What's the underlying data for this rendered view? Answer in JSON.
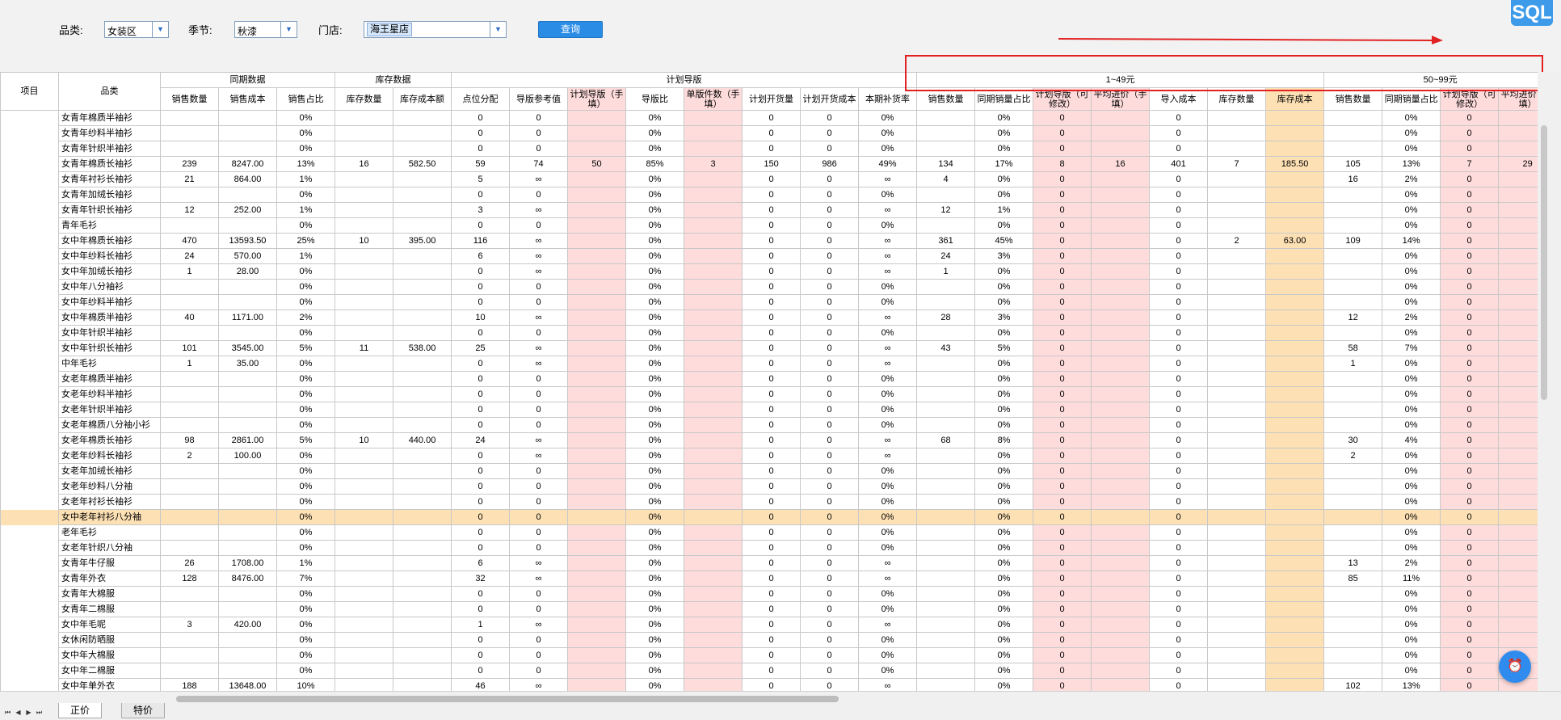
{
  "filters": {
    "category_label": "品类:",
    "category_value": "女装区",
    "season_label": "季节:",
    "season_value": "秋漆",
    "store_label": "门店:",
    "store_value": "海王星店",
    "query_label": "查询"
  },
  "sql_badge": "SQL",
  "float_button_icon": "notification-icon",
  "header_groups": {
    "item": "项目",
    "category": "品类",
    "prior": "同期数据",
    "stock": "库存数据",
    "plan": "计划导版",
    "price1": "1~49元",
    "price2": "50~99元"
  },
  "columns": [
    "销售数量",
    "销售成本",
    "销售占比",
    "库存数量",
    "库存成本额",
    "点位分配",
    "导版参考值",
    "计划导版（手填）",
    "导版比",
    "单版件数（手填）",
    "计划开货量",
    "计划开货成本",
    "本期补货率",
    "销售数量",
    "同期销量占比",
    "计划导版（可修改）",
    "平均进价（手填）",
    "导入成本",
    "库存数量",
    "库存成本",
    "销售数量",
    "同期销量占比",
    "计划导版（可修改）",
    "平均进价（手填）"
  ],
  "rows": [
    [
      "女青年棉质半袖衫",
      "",
      "",
      "0%",
      "",
      "",
      "0",
      "0",
      "",
      "0%",
      "",
      "0",
      "0",
      "0%",
      "",
      "0%",
      "0",
      "",
      "0",
      "",
      "",
      "",
      "0%",
      "0",
      ""
    ],
    [
      "女青年纱料半袖衫",
      "",
      "",
      "0%",
      "",
      "",
      "0",
      "0",
      "",
      "0%",
      "",
      "0",
      "0",
      "0%",
      "",
      "0%",
      "0",
      "",
      "0",
      "",
      "",
      "",
      "0%",
      "0",
      ""
    ],
    [
      "女青年针织半袖衫",
      "",
      "",
      "0%",
      "",
      "",
      "0",
      "0",
      "",
      "0%",
      "",
      "0",
      "0",
      "0%",
      "",
      "0%",
      "0",
      "",
      "0",
      "",
      "",
      "",
      "0%",
      "0",
      ""
    ],
    [
      "女青年棉质长袖衫",
      "239",
      "8247.00",
      "13%",
      "16",
      "582.50",
      "59",
      "74",
      "50",
      "85%",
      "3",
      "150",
      "986",
      "49%",
      "134",
      "17%",
      "8",
      "16",
      "401",
      "7",
      "185.50",
      "105",
      "13%",
      "7",
      "29"
    ],
    [
      "女青年衬衫长袖衫",
      "21",
      "864.00",
      "1%",
      "",
      "",
      "5",
      "∞",
      "",
      "0%",
      "",
      "0",
      "0",
      "∞",
      "4",
      "0%",
      "0",
      "",
      "0",
      "",
      "",
      "16",
      "2%",
      "0",
      ""
    ],
    [
      "女青年加绒长袖衫",
      "",
      "",
      "0%",
      "",
      "",
      "0",
      "0",
      "",
      "0%",
      "",
      "0",
      "0",
      "0%",
      "",
      "0%",
      "0",
      "",
      "0",
      "",
      "",
      "",
      "0%",
      "0",
      ""
    ],
    [
      "女青年针织长袖衫",
      "12",
      "252.00",
      "1%",
      "",
      "",
      "3",
      "∞",
      "",
      "0%",
      "",
      "0",
      "0",
      "∞",
      "12",
      "1%",
      "0",
      "",
      "0",
      "",
      "",
      "",
      "0%",
      "0",
      ""
    ],
    [
      "青年毛衫",
      "",
      "",
      "0%",
      "",
      "",
      "0",
      "0",
      "",
      "0%",
      "",
      "0",
      "0",
      "0%",
      "",
      "0%",
      "0",
      "",
      "0",
      "",
      "",
      "",
      "0%",
      "0",
      ""
    ],
    [
      "女中年棉质长袖衫",
      "470",
      "13593.50",
      "25%",
      "10",
      "395.00",
      "116",
      "∞",
      "",
      "0%",
      "",
      "0",
      "0",
      "∞",
      "361",
      "45%",
      "0",
      "",
      "0",
      "2",
      "63.00",
      "109",
      "14%",
      "0",
      ""
    ],
    [
      "女中年纱料长袖衫",
      "24",
      "570.00",
      "1%",
      "",
      "",
      "6",
      "∞",
      "",
      "0%",
      "",
      "0",
      "0",
      "∞",
      "24",
      "3%",
      "0",
      "",
      "0",
      "",
      "",
      "",
      "0%",
      "0",
      ""
    ],
    [
      "女中年加绒长袖衫",
      "1",
      "28.00",
      "0%",
      "",
      "",
      "0",
      "∞",
      "",
      "0%",
      "",
      "0",
      "0",
      "∞",
      "1",
      "0%",
      "0",
      "",
      "0",
      "",
      "",
      "",
      "0%",
      "0",
      ""
    ],
    [
      "女中年八分袖衫",
      "",
      "",
      "0%",
      "",
      "",
      "0",
      "0",
      "",
      "0%",
      "",
      "0",
      "0",
      "0%",
      "",
      "0%",
      "0",
      "",
      "0",
      "",
      "",
      "",
      "0%",
      "0",
      ""
    ],
    [
      "女中年纱料半袖衫",
      "",
      "",
      "0%",
      "",
      "",
      "0",
      "0",
      "",
      "0%",
      "",
      "0",
      "0",
      "0%",
      "",
      "0%",
      "0",
      "",
      "0",
      "",
      "",
      "",
      "0%",
      "0",
      ""
    ],
    [
      "女中年棉质半袖衫",
      "40",
      "1171.00",
      "2%",
      "",
      "",
      "10",
      "∞",
      "",
      "0%",
      "",
      "0",
      "0",
      "∞",
      "28",
      "3%",
      "0",
      "",
      "0",
      "",
      "",
      "12",
      "2%",
      "0",
      ""
    ],
    [
      "女中年针织半袖衫",
      "",
      "",
      "0%",
      "",
      "",
      "0",
      "0",
      "",
      "0%",
      "",
      "0",
      "0",
      "0%",
      "",
      "0%",
      "0",
      "",
      "0",
      "",
      "",
      "",
      "0%",
      "0",
      ""
    ],
    [
      "女中年针织长袖衫",
      "101",
      "3545.00",
      "5%",
      "11",
      "538.00",
      "25",
      "∞",
      "",
      "0%",
      "",
      "0",
      "0",
      "∞",
      "43",
      "5%",
      "0",
      "",
      "0",
      "",
      "",
      "58",
      "7%",
      "0",
      ""
    ],
    [
      "中年毛衫",
      "1",
      "35.00",
      "0%",
      "",
      "",
      "0",
      "∞",
      "",
      "0%",
      "",
      "0",
      "0",
      "∞",
      "",
      "0%",
      "0",
      "",
      "0",
      "",
      "",
      "1",
      "0%",
      "0",
      ""
    ],
    [
      "女老年棉质半袖衫",
      "",
      "",
      "0%",
      "",
      "",
      "0",
      "0",
      "",
      "0%",
      "",
      "0",
      "0",
      "0%",
      "",
      "0%",
      "0",
      "",
      "0",
      "",
      "",
      "",
      "0%",
      "0",
      ""
    ],
    [
      "女老年纱料半袖衫",
      "",
      "",
      "0%",
      "",
      "",
      "0",
      "0",
      "",
      "0%",
      "",
      "0",
      "0",
      "0%",
      "",
      "0%",
      "0",
      "",
      "0",
      "",
      "",
      "",
      "0%",
      "0",
      ""
    ],
    [
      "女老年针织半袖衫",
      "",
      "",
      "0%",
      "",
      "",
      "0",
      "0",
      "",
      "0%",
      "",
      "0",
      "0",
      "0%",
      "",
      "0%",
      "0",
      "",
      "0",
      "",
      "",
      "",
      "0%",
      "0",
      ""
    ],
    [
      "女老年棉质八分袖小衫",
      "",
      "",
      "0%",
      "",
      "",
      "0",
      "0",
      "",
      "0%",
      "",
      "0",
      "0",
      "0%",
      "",
      "0%",
      "0",
      "",
      "0",
      "",
      "",
      "",
      "0%",
      "0",
      ""
    ],
    [
      "女老年棉质长袖衫",
      "98",
      "2861.00",
      "5%",
      "10",
      "440.00",
      "24",
      "∞",
      "",
      "0%",
      "",
      "0",
      "0",
      "∞",
      "68",
      "8%",
      "0",
      "",
      "0",
      "",
      "",
      "30",
      "4%",
      "0",
      ""
    ],
    [
      "女老年纱料长袖衫",
      "2",
      "100.00",
      "0%",
      "",
      "",
      "0",
      "∞",
      "",
      "0%",
      "",
      "0",
      "0",
      "∞",
      "",
      "0%",
      "0",
      "",
      "0",
      "",
      "",
      "2",
      "0%",
      "0",
      ""
    ],
    [
      "女老年加绒长袖衫",
      "",
      "",
      "0%",
      "",
      "",
      "0",
      "0",
      "",
      "0%",
      "",
      "0",
      "0",
      "0%",
      "",
      "0%",
      "0",
      "",
      "0",
      "",
      "",
      "",
      "0%",
      "0",
      ""
    ],
    [
      "女老年纱料八分袖",
      "",
      "",
      "0%",
      "",
      "",
      "0",
      "0",
      "",
      "0%",
      "",
      "0",
      "0",
      "0%",
      "",
      "0%",
      "0",
      "",
      "0",
      "",
      "",
      "",
      "0%",
      "0",
      ""
    ],
    [
      "女老年衬衫长袖衫",
      "",
      "",
      "0%",
      "",
      "",
      "0",
      "0",
      "",
      "0%",
      "",
      "0",
      "0",
      "0%",
      "",
      "0%",
      "0",
      "",
      "0",
      "",
      "",
      "",
      "0%",
      "0",
      ""
    ],
    [
      "女中老年衬衫八分袖",
      "",
      "",
      "0%",
      "",
      "",
      "0",
      "0",
      "",
      "0%",
      "",
      "0",
      "0",
      "0%",
      "",
      "0%",
      "0",
      "",
      "0",
      "",
      "",
      "",
      "0%",
      "0",
      ""
    ],
    [
      "老年毛衫",
      "",
      "",
      "0%",
      "",
      "",
      "0",
      "0",
      "",
      "0%",
      "",
      "0",
      "0",
      "0%",
      "",
      "0%",
      "0",
      "",
      "0",
      "",
      "",
      "",
      "0%",
      "0",
      ""
    ],
    [
      "女老年针织八分袖",
      "",
      "",
      "0%",
      "",
      "",
      "0",
      "0",
      "",
      "0%",
      "",
      "0",
      "0",
      "0%",
      "",
      "0%",
      "0",
      "",
      "0",
      "",
      "",
      "",
      "0%",
      "0",
      ""
    ],
    [
      "女青年牛仔服",
      "26",
      "1708.00",
      "1%",
      "",
      "",
      "6",
      "∞",
      "",
      "0%",
      "",
      "0",
      "0",
      "∞",
      "",
      "0%",
      "0",
      "",
      "0",
      "",
      "",
      "13",
      "2%",
      "0",
      ""
    ],
    [
      "女青年外衣",
      "128",
      "8476.00",
      "7%",
      "",
      "",
      "32",
      "∞",
      "",
      "0%",
      "",
      "0",
      "0",
      "∞",
      "",
      "0%",
      "0",
      "",
      "0",
      "",
      "",
      "85",
      "11%",
      "0",
      ""
    ],
    [
      "女青年大棉服",
      "",
      "",
      "0%",
      "",
      "",
      "0",
      "0",
      "",
      "0%",
      "",
      "0",
      "0",
      "0%",
      "",
      "0%",
      "0",
      "",
      "0",
      "",
      "",
      "",
      "0%",
      "0",
      ""
    ],
    [
      "女青年二棉服",
      "",
      "",
      "0%",
      "",
      "",
      "0",
      "0",
      "",
      "0%",
      "",
      "0",
      "0",
      "0%",
      "",
      "0%",
      "0",
      "",
      "0",
      "",
      "",
      "",
      "0%",
      "0",
      ""
    ],
    [
      "女中年毛呢",
      "3",
      "420.00",
      "0%",
      "",
      "",
      "1",
      "∞",
      "",
      "0%",
      "",
      "0",
      "0",
      "∞",
      "",
      "0%",
      "0",
      "",
      "0",
      "",
      "",
      "",
      "0%",
      "0",
      ""
    ],
    [
      "女休闲防晒服",
      "",
      "",
      "0%",
      "",
      "",
      "0",
      "0",
      "",
      "0%",
      "",
      "0",
      "0",
      "0%",
      "",
      "0%",
      "0",
      "",
      "0",
      "",
      "",
      "",
      "0%",
      "0",
      ""
    ],
    [
      "女中年大棉服",
      "",
      "",
      "0%",
      "",
      "",
      "0",
      "0",
      "",
      "0%",
      "",
      "0",
      "0",
      "0%",
      "",
      "0%",
      "0",
      "",
      "0",
      "",
      "",
      "",
      "0%",
      "0",
      ""
    ],
    [
      "女中年二棉服",
      "",
      "",
      "0%",
      "",
      "",
      "0",
      "0",
      "",
      "0%",
      "",
      "0",
      "0",
      "0%",
      "",
      "0%",
      "0",
      "",
      "0",
      "",
      "",
      "",
      "0%",
      "0",
      ""
    ],
    [
      "女中年单外衣",
      "188",
      "13648.00",
      "10%",
      "",
      "",
      "46",
      "∞",
      "",
      "0%",
      "",
      "0",
      "0",
      "∞",
      "",
      "0%",
      "0",
      "",
      "0",
      "",
      "",
      "102",
      "13%",
      "0",
      ""
    ]
  ],
  "highlight_row": 26,
  "sheets": [
    "正价",
    "特价"
  ],
  "colors": {
    "pink": "#ffdcdc",
    "orange": "#fde0b4",
    "accent": "#2b8ce6",
    "redbox": "#e22222"
  }
}
